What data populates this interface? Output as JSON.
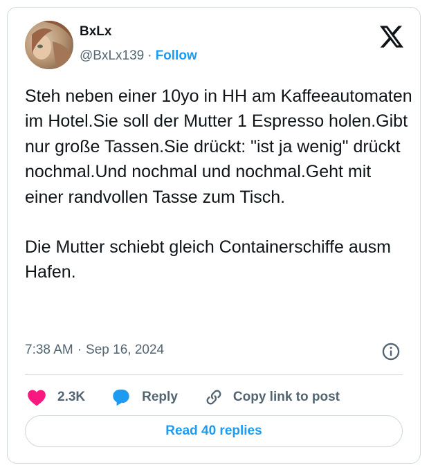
{
  "author": {
    "name": "BxLx",
    "handle": "@BxLx139",
    "separator": "·",
    "follow_label": "Follow"
  },
  "tweet": {
    "paragraphs": [
      "Steh neben einer 10yo in HH am Kaffeeautomaten im Hotel.Sie soll der Mutter 1 Espresso holen.Gibt nur große Tassen.Sie drückt: \"ist ja wenig\" drückt nochmal.Und nochmal und nochmal.Geht mit einer randvollen Tasse zum Tisch.",
      "Die Mutter schiebt gleich Containerschiffe ausm Hafen."
    ]
  },
  "meta": {
    "time": "7:38 AM",
    "separator": "·",
    "date": "Sep 16, 2024"
  },
  "actions": {
    "like_count": "2.3K",
    "reply_label": "Reply",
    "copy_link_label": "Copy link to post"
  },
  "read_replies_label": "Read 40 replies",
  "icons": {
    "logo": "x-logo-icon",
    "info": "info-icon",
    "like": "heart-icon",
    "reply": "speech-bubble-icon",
    "copy": "link-icon"
  },
  "colors": {
    "accent": "#1d9bf0",
    "like": "#f91880",
    "secondary_text": "#536471",
    "border": "#cfd9de"
  }
}
